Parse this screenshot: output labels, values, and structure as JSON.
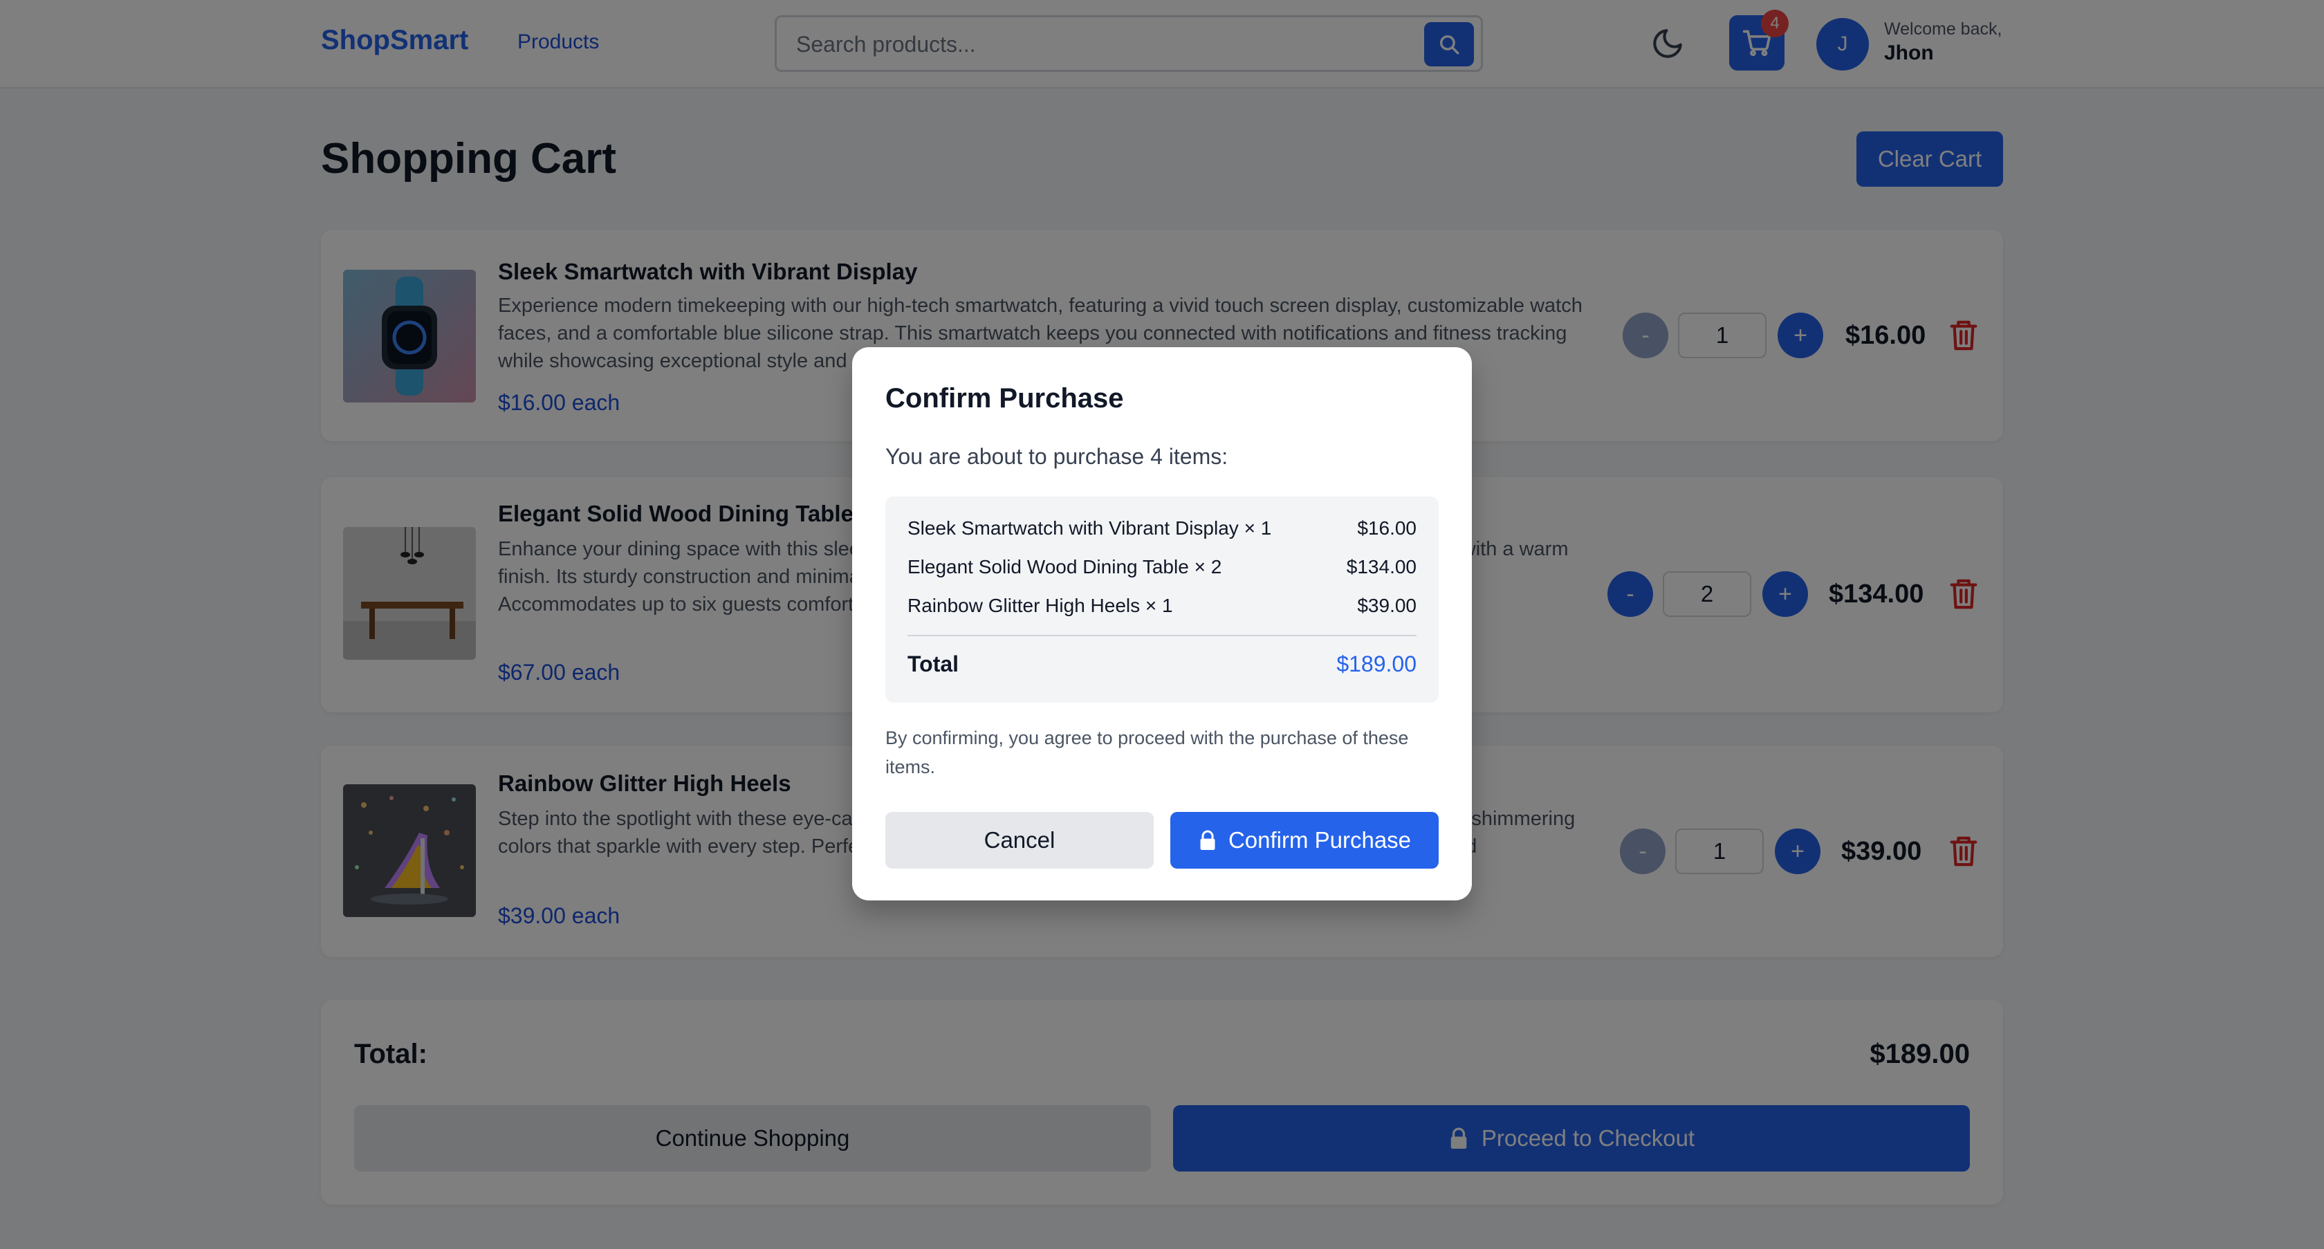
{
  "header": {
    "logo": "ShopSmart",
    "nav_products": "Products",
    "search_placeholder": "Search products...",
    "cart_count": "4",
    "avatar_initial": "J",
    "welcome": "Welcome back,",
    "username": "Jhon"
  },
  "page": {
    "title": "Shopping Cart",
    "clear_cart": "Clear Cart"
  },
  "items": [
    {
      "title": "Sleek Smartwatch with Vibrant Display",
      "desc": "Experience modern timekeeping with our high-tech smartwatch, featuring a vivid touch screen display, customizable watch faces, and a comfortable blue silicone strap. This smartwatch keeps you connected with notifications and fitness tracking while showcasing exceptional style and",
      "price": "$16.00 each",
      "qty": "1",
      "line_total": "$16.00",
      "minus_enabled": false
    },
    {
      "title": "Elegant Solid Wood Dining Table",
      "desc": "Enhance your dining space with this sleek, rectangular solid wood dining table, featuring a minimalist design with a warm finish. Its sturdy construction and minimalist aesthetic make it a perfect centerpiece with a touch of elegance. Accommodates up to six guests comfortably. Overhead lighting is not included.",
      "price": "$67.00 each",
      "qty": "2",
      "line_total": "$134.00",
      "minus_enabled": true
    },
    {
      "title": "Rainbow Glitter High Heels",
      "desc": "Step into the spotlight with these eye-catching rainbow glitter high heels. Each shoe boasts a kaleidoscope of shimmering colors that sparkle with every step. Perfect for a party or a night out, these stunners are sure to turn heads and",
      "price": "$39.00 each",
      "qty": "1",
      "line_total": "$39.00",
      "minus_enabled": false
    }
  ],
  "summary": {
    "label": "Total:",
    "value": "$189.00",
    "continue": "Continue Shopping",
    "checkout": "Proceed to Checkout"
  },
  "modal": {
    "title": "Confirm Purchase",
    "intro": "You are about to purchase 4 items:",
    "rows": [
      {
        "name": "Sleek Smartwatch with Vibrant Display × 1",
        "price": "$16.00"
      },
      {
        "name": "Elegant Solid Wood Dining Table × 2",
        "price": "$134.00"
      },
      {
        "name": "Rainbow Glitter High Heels × 1",
        "price": "$39.00"
      }
    ],
    "total_label": "Total",
    "total_value": "$189.00",
    "note": "By confirming, you agree to proceed with the purchase of these items.",
    "cancel": "Cancel",
    "confirm": "Confirm Purchase"
  },
  "colors": {
    "accent": "#2563eb",
    "danger": "#dc2626",
    "badge": "#ef4444"
  },
  "icons": [
    "search-icon",
    "moon-icon",
    "cart-icon",
    "trash-icon",
    "lock-icon"
  ]
}
